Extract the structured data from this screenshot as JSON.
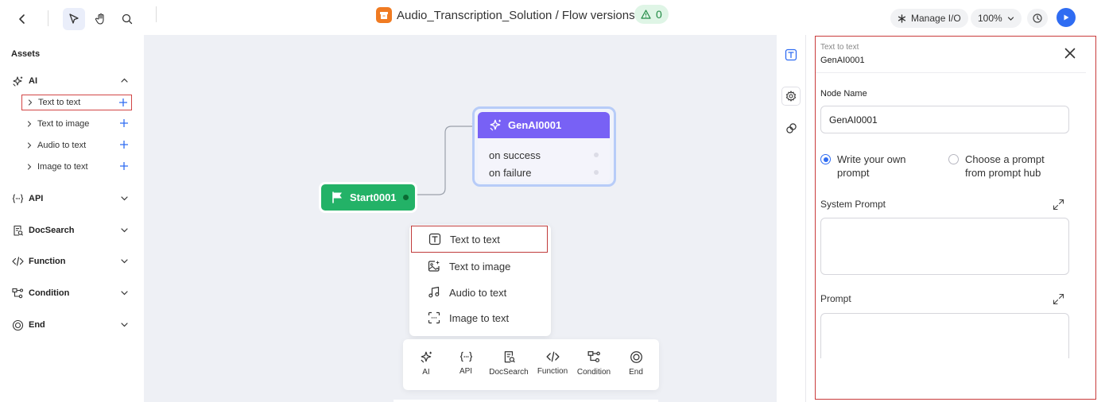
{
  "topbar": {
    "title": "Audio_Transcription_Solution / Flow versions",
    "warning_count": "0",
    "manage_io_label": "Manage I/O",
    "zoom_label": "100%"
  },
  "sidebar": {
    "title": "Assets",
    "categories": [
      {
        "label": "AI",
        "expanded": true,
        "icon": "sparkle-icon",
        "items": [
          {
            "label": "Text to text",
            "selected": true
          },
          {
            "label": "Text to image"
          },
          {
            "label": "Audio to text"
          },
          {
            "label": "Image to text"
          }
        ]
      },
      {
        "label": "API",
        "icon": "braces-icon"
      },
      {
        "label": "DocSearch",
        "icon": "doc-search-icon"
      },
      {
        "label": "Function",
        "icon": "code-icon"
      },
      {
        "label": "Condition",
        "icon": "branch-icon"
      },
      {
        "label": "End",
        "icon": "end-circle-icon"
      }
    ]
  },
  "canvas": {
    "genai_node": {
      "title": "GenAI0001",
      "outlets": [
        "on success",
        "on failure"
      ]
    },
    "start_node": {
      "title": "Start0001"
    },
    "popup_menu": {
      "items": [
        {
          "label": "Text to text",
          "icon": "text-box-icon",
          "selected": true
        },
        {
          "label": "Text to image",
          "icon": "image-sparkle-icon"
        },
        {
          "label": "Audio to text",
          "icon": "music-note-icon"
        },
        {
          "label": "Image to text",
          "icon": "image-scan-icon"
        }
      ]
    },
    "bottom_toolbar": {
      "items": [
        {
          "label": "AI",
          "icon": "sparkle-icon"
        },
        {
          "label": "API",
          "icon": "braces-icon"
        },
        {
          "label": "DocSearch",
          "icon": "doc-search-icon"
        },
        {
          "label": "Function",
          "icon": "code-icon"
        },
        {
          "label": "Condition",
          "icon": "branch-icon"
        },
        {
          "label": "End",
          "icon": "end-circle-icon"
        }
      ]
    }
  },
  "panel": {
    "node_type": "Text to text",
    "node_title": "GenAI0001",
    "node_name_label": "Node Name",
    "node_name_value": "GenAI0001",
    "radio_options": [
      {
        "line1": "Write your own",
        "line2": "prompt",
        "checked": true
      },
      {
        "line1": "Choose a prompt",
        "line2": "from prompt hub",
        "checked": false
      }
    ],
    "system_prompt_label": "System Prompt",
    "prompt_label": "Prompt"
  },
  "colors": {
    "accent_blue": "#2f6cf2",
    "genai_purple": "#7861f5",
    "start_green": "#23b267",
    "selection_red": "#c93b3b",
    "canvas_bg": "#eef0f5"
  }
}
